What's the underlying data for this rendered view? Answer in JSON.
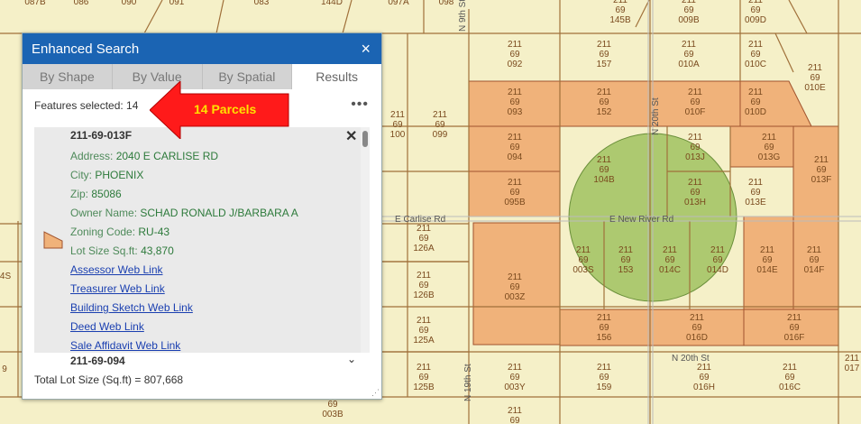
{
  "panel": {
    "title": "Enhanced Search",
    "close_icon": "×",
    "tabs": [
      {
        "label": "By Shape"
      },
      {
        "label": "By Value"
      },
      {
        "label": "By Spatial"
      },
      {
        "label": "Results"
      }
    ],
    "active_tab": "Results",
    "features_selected": "Features selected: 14",
    "more_icon": "•••",
    "record": {
      "parcel_id": "211-69-013F",
      "address": {
        "label": "Address:",
        "value": "2040 E CARLISE RD"
      },
      "city": {
        "label": "City:",
        "value": "PHOENIX"
      },
      "zip": {
        "label": "Zip:",
        "value": "85086"
      },
      "owner": {
        "label": "Owner Name:",
        "value": "SCHAD RONALD J/BARBARA A"
      },
      "zoning": {
        "label": "Zoning Code:",
        "value": "RU-43"
      },
      "lot_size": {
        "label": "Lot Size Sq.ft:",
        "value": "43,870"
      },
      "links": [
        "Assessor Web Link",
        "Treasurer Web Link",
        "Building Sketch Web Link",
        "Deed Web Link",
        "Sale Affidavit Web Link"
      ]
    },
    "record_close_icon": "✕",
    "next_record_id": "211-69-094",
    "chevron_icon": "⌄",
    "total": "Total Lot Size (Sq.ft) = 807,668",
    "resize_icon": "⋰"
  },
  "callout": {
    "text": "14 Parcels",
    "color": "#ff1a1a",
    "text_color": "#ffe100"
  },
  "map": {
    "streets": [
      "E Carlise Rd",
      "E New River Rd",
      "N 20th St",
      "N 19th St",
      "N 20th St",
      "N 9th St"
    ],
    "parcels": [
      {
        "l1": "211",
        "l2": "69",
        "l3": "093"
      },
      {
        "l1": "211",
        "l2": "69",
        "l3": "152"
      },
      {
        "l1": "211",
        "l2": "69",
        "l3": "010F"
      },
      {
        "l1": "211",
        "l2": "69",
        "l3": "010D"
      },
      {
        "l1": "211",
        "l2": "69",
        "l3": "013J"
      },
      {
        "l1": "211",
        "l2": "69",
        "l3": "013G"
      },
      {
        "l1": "211",
        "l2": "69",
        "l3": "013F"
      },
      {
        "l1": "211",
        "l2": "69",
        "l3": "094"
      },
      {
        "l1": "211",
        "l2": "69",
        "l3": "104B"
      },
      {
        "l1": "211",
        "l2": "69",
        "l3": "013H"
      },
      {
        "l1": "211",
        "l2": "69",
        "l3": "013E"
      },
      {
        "l1": "211",
        "l2": "69",
        "l3": "095B"
      },
      {
        "l1": "211",
        "l2": "69",
        "l3": "003Z"
      },
      {
        "l1": "211",
        "l2": "69",
        "l3": "003S"
      },
      {
        "l1": "211",
        "l2": "69",
        "l3": "153"
      },
      {
        "l1": "211",
        "l2": "69",
        "l3": "014C"
      },
      {
        "l1": "211",
        "l2": "69",
        "l3": "014D"
      },
      {
        "l1": "211",
        "l2": "69",
        "l3": "014E"
      },
      {
        "l1": "211",
        "l2": "69",
        "l3": "014F"
      },
      {
        "l1": "211",
        "l2": "69",
        "l3": "156"
      },
      {
        "l1": "211",
        "l2": "69",
        "l3": "016D"
      },
      {
        "l1": "211",
        "l2": "69",
        "l3": "016F"
      },
      {
        "l1": "211",
        "l2": "69",
        "l3": "092"
      },
      {
        "l1": "211",
        "l2": "69",
        "l3": "157"
      },
      {
        "l1": "211",
        "l2": "69",
        "l3": "010A"
      },
      {
        "l1": "211",
        "l2": "69",
        "l3": "010C"
      },
      {
        "l1": "211",
        "l2": "69",
        "l3": "010E"
      },
      {
        "l1": "211",
        "l2": "69",
        "l3": "100"
      },
      {
        "l1": "211",
        "l2": "69",
        "l3": "099"
      },
      {
        "l1": "211",
        "l2": "69",
        "l3": "126A"
      },
      {
        "l1": "211",
        "l2": "69",
        "l3": "126B"
      },
      {
        "l1": "211",
        "l2": "69",
        "l3": "125A"
      },
      {
        "l1": "211",
        "l2": "69",
        "l3": "125B"
      },
      {
        "l1": "211",
        "l2": "69",
        "l3": "003Y"
      },
      {
        "l1": "211",
        "l2": "69",
        "l3": "159"
      },
      {
        "l1": "211",
        "l2": "69",
        "l3": "016H"
      },
      {
        "l1": "211",
        "l2": "69",
        "l3": "016C"
      },
      {
        "l1": "211",
        "l2": "69",
        "l3": "145B"
      },
      {
        "l1": "211",
        "l2": "69",
        "l3": "009B"
      },
      {
        "l1": "211",
        "l2": "69",
        "l3": "009D"
      },
      {
        "l1": "",
        "l2": "69",
        "l3": "003B"
      },
      {
        "l1": "211",
        "l2": "69",
        "l3": ""
      }
    ],
    "top_fragments": [
      "087B",
      "086",
      "090",
      "091",
      "083",
      "144D",
      "097A",
      "098"
    ],
    "left_fragments": [
      "4S",
      "9"
    ],
    "right_fragments": [
      "211",
      "017"
    ],
    "selected_fill": "#f0b27a",
    "buffer_fill": "#9bbf5a"
  }
}
